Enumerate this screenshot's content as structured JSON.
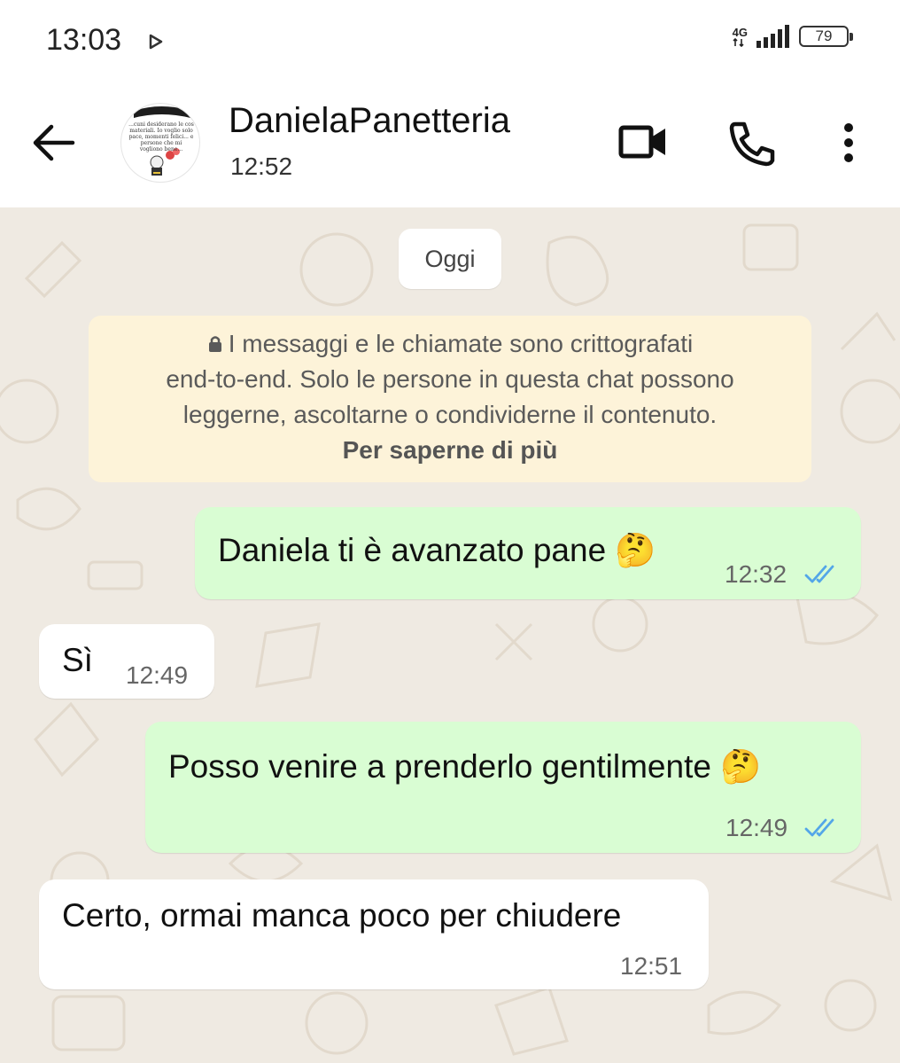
{
  "status_bar": {
    "time": "13:03",
    "network": "4G",
    "battery": "79"
  },
  "header": {
    "contact_name": "DanielaPanetteria",
    "subtitle": "12:52",
    "avatar_text": "...cuni desiderano le cos materiali. Io voglio solo pace, momenti felici... e persone che mi vogliono bene..."
  },
  "chat": {
    "date_chip": "Oggi",
    "encryption": {
      "line1": "I messaggi e le chiamate sono crittografati",
      "line2": "end-to-end. Solo le persone in questa chat possono",
      "line3": "leggerne, ascoltarne o condividerne il contenuto.",
      "link": "Per saperne di più"
    },
    "messages": [
      {
        "direction": "outgoing",
        "text": "Daniela ti è avanzato pane 🤔",
        "time": "12:32",
        "status": "read"
      },
      {
        "direction": "incoming",
        "text": "Sì",
        "time": "12:49"
      },
      {
        "direction": "outgoing",
        "text": "Posso venire a prenderlo gentilmente 🤔",
        "time": "12:49",
        "status": "read"
      },
      {
        "direction": "incoming",
        "text": "Certo, ormai manca poco per chiudere",
        "time": "12:51"
      }
    ]
  },
  "colors": {
    "outgoing_bubble": "#d9fdd3",
    "incoming_bubble": "#ffffff",
    "chat_background": "#efeae2",
    "read_ticks": "#53a6e8",
    "encryption_notice": "#fdf3d9"
  },
  "icons": [
    "back-arrow-icon",
    "video-call-icon",
    "phone-icon",
    "more-options-icon",
    "lock-icon",
    "double-check-icon",
    "play-store-icon"
  ]
}
